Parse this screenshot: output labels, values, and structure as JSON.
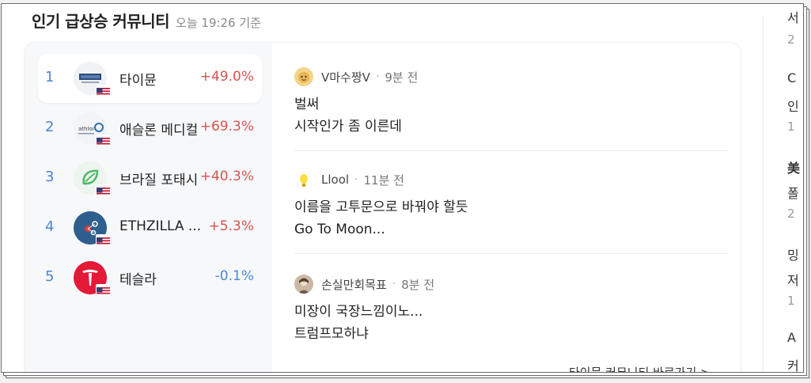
{
  "header": {
    "title": "인기 급상승 커뮤니티",
    "timestamp": "오늘 19:26 기준"
  },
  "rankings": [
    {
      "rank": "1",
      "name": "타이뮨",
      "change": "+49.0%",
      "direction": "up",
      "logo": "tyme-logo",
      "flag": "us-flag-icon"
    },
    {
      "rank": "2",
      "name": "애슬론 메디컬",
      "change": "+69.3%",
      "direction": "up",
      "logo": "athlon-logo",
      "flag": "us-flag-icon"
    },
    {
      "rank": "3",
      "name": "브라질 포태시",
      "change": "+40.3%",
      "direction": "up",
      "logo": "brazil-potash-logo",
      "flag": "us-flag-icon"
    },
    {
      "rank": "4",
      "name": "ETHZILLA ...",
      "change": "+5.3%",
      "direction": "up",
      "logo": "ethzilla-logo",
      "flag": "us-flag-icon"
    },
    {
      "rank": "5",
      "name": "테슬라",
      "change": "-0.1%",
      "direction": "down",
      "logo": "tesla-logo",
      "flag": "us-flag-icon"
    }
  ],
  "posts": [
    {
      "author": "V마수짱V",
      "separator": "·",
      "time": "9분 전",
      "line1": "벌써",
      "line2": "시작인가 좀 이른데"
    },
    {
      "author": "Llool",
      "separator": "·",
      "time": "11분 전",
      "line1": "이름을 고투문으로 바꿔야 할듯",
      "line2": "Go To Moon..."
    },
    {
      "author": "손실만회목표",
      "separator": "·",
      "time": "8분 전",
      "line1": "미장이 국장느낌이노...",
      "line2": "트럼프모하냐"
    }
  ],
  "partial_footer_text": "타이뮨 커뮤니티 바로가기 >",
  "side_column": [
    "서",
    "2",
    "C",
    "인",
    "1",
    "美",
    "폴",
    "2",
    "밍",
    "저",
    "1",
    "A",
    "커"
  ],
  "colors": {
    "up": "#d9534f",
    "down": "#4a86d6",
    "rank": "#4a86d6",
    "tesla": "#e31937"
  }
}
